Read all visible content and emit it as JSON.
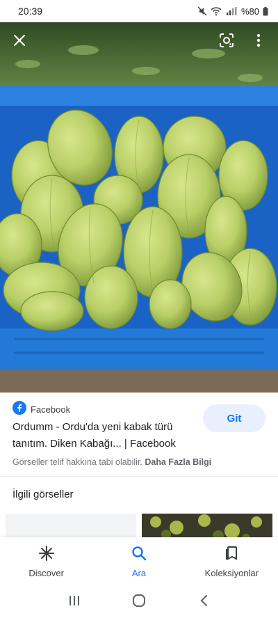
{
  "status_bar": {
    "time": "20:39",
    "battery": "%80"
  },
  "image_viewer": {
    "close_icon": "close-icon",
    "lens_icon": "google-lens-icon",
    "more_icon": "more-vert-icon"
  },
  "result": {
    "source_name": "Facebook",
    "title": "Ordumm - Ordu'da yeni kabak türü tanıtım. Diken Kabağı... | Facebook",
    "visit_button": "Git",
    "copyright_notice": "Görseller telif hakkına tabi olabilir.",
    "more_info_link": "Daha Fazla Bilgi"
  },
  "related": {
    "heading": "İlgili görseller"
  },
  "bottom_nav": {
    "items": [
      {
        "label": "Discover",
        "icon": "asterisk-icon"
      },
      {
        "label": "Ara",
        "icon": "search-icon"
      },
      {
        "label": "Koleksiyonlar",
        "icon": "collections-icon"
      }
    ],
    "active_index": 1
  },
  "colors": {
    "accent": "#1a73e8",
    "button_bg": "#e8f0fe",
    "crate_blue": "#1d6fd1",
    "fruit_green": "#b9cf67"
  }
}
